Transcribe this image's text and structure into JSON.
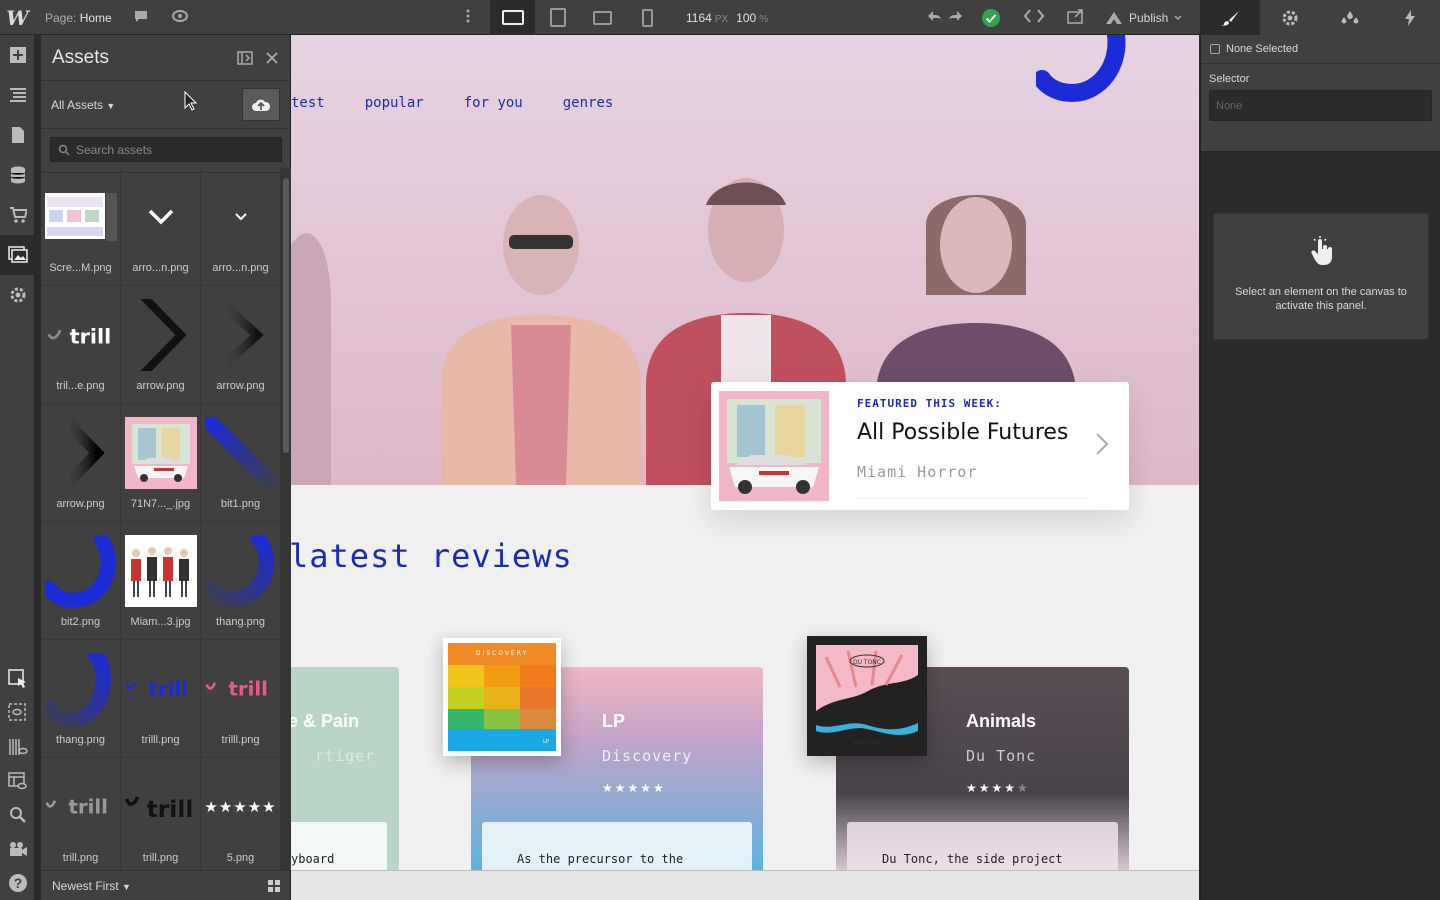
{
  "topbar": {
    "page_prefix": "Page:",
    "page_name": "Home",
    "width_value": "1164",
    "width_unit": "PX",
    "zoom_value": "100",
    "zoom_unit": "%",
    "publish_label": "Publish"
  },
  "assets_panel": {
    "title": "Assets",
    "filter_label": "All Assets",
    "search_placeholder": "Search assets",
    "sort_label": "Newest First",
    "items": [
      {
        "name": "Scre...M.png"
      },
      {
        "name": "arro...n.png"
      },
      {
        "name": "arro...n.png"
      },
      {
        "name": "tril...e.png"
      },
      {
        "name": "arrow.png"
      },
      {
        "name": "arrow.png"
      },
      {
        "name": "arrow.png"
      },
      {
        "name": "71N7..._.jpg"
      },
      {
        "name": "bit1.png"
      },
      {
        "name": "bit2.png"
      },
      {
        "name": "Miam...3.jpg"
      },
      {
        "name": "thang.png"
      },
      {
        "name": "thang.png"
      },
      {
        "name": "trilll.png"
      },
      {
        "name": "trilll.png"
      },
      {
        "name": "trill.png"
      },
      {
        "name": "trill.png"
      },
      {
        "name": "5.png"
      }
    ],
    "trill_text": "trill"
  },
  "site": {
    "nav": [
      "test",
      "popular",
      "for you",
      "genres"
    ],
    "featured": {
      "kicker": "FEATURED THIS WEEK:",
      "title": "All Possible Futures",
      "artist": "Miami Horror"
    },
    "reviews_heading": "latest reviews",
    "cards": [
      {
        "type": "re & Pain",
        "artist": "rtiger",
        "desc": "yboard"
      },
      {
        "type": "LP",
        "artist": "Discovery",
        "desc": "As the precursor to the"
      },
      {
        "type": "Animals",
        "artist": "Du Tonc",
        "desc": "Du Tonc, the side project"
      }
    ],
    "album_discovery_label": "DISCOVERY",
    "album_dutonc_label": "DU TONC",
    "album_dutonc_script": "Animals",
    "album_lp_tag": "LP"
  },
  "right_panel": {
    "none_selected": "None Selected",
    "selector_label": "Selector",
    "selector_placeholder": "None",
    "message": "Select an element on the canvas to activate this panel."
  },
  "colors": {
    "accent_blue": "#1b2bb6",
    "publish_ok": "#2ea44f"
  }
}
